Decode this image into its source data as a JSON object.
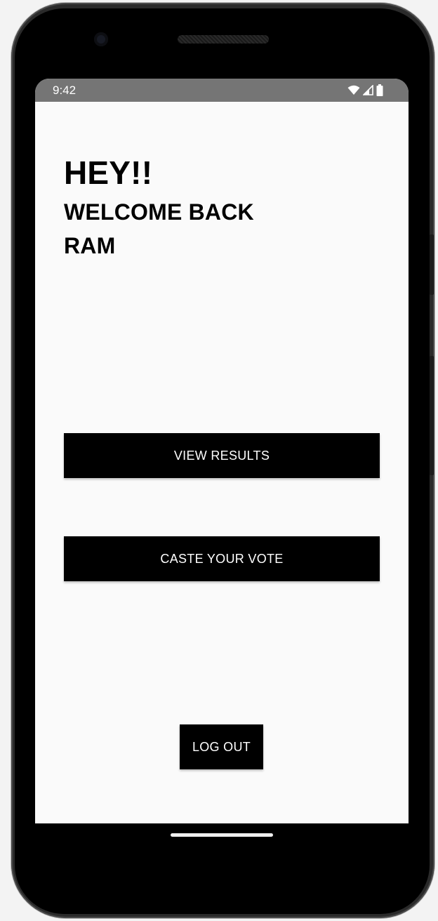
{
  "status_bar": {
    "time": "9:42",
    "icons": [
      "wifi-icon",
      "cell-signal-icon",
      "battery-icon"
    ]
  },
  "greeting": {
    "line1": "HEY!!",
    "line2": "WELCOME BACK",
    "line3": "RAM"
  },
  "buttons": {
    "view_results": "VIEW RESULTS",
    "cast_vote": "CASTE YOUR VOTE",
    "log_out": "LOG OUT"
  },
  "colors": {
    "screen_bg": "#fafafa",
    "status_bar_bg": "#757575",
    "button_bg": "#000000",
    "button_text": "#ffffff",
    "text": "#000000"
  }
}
